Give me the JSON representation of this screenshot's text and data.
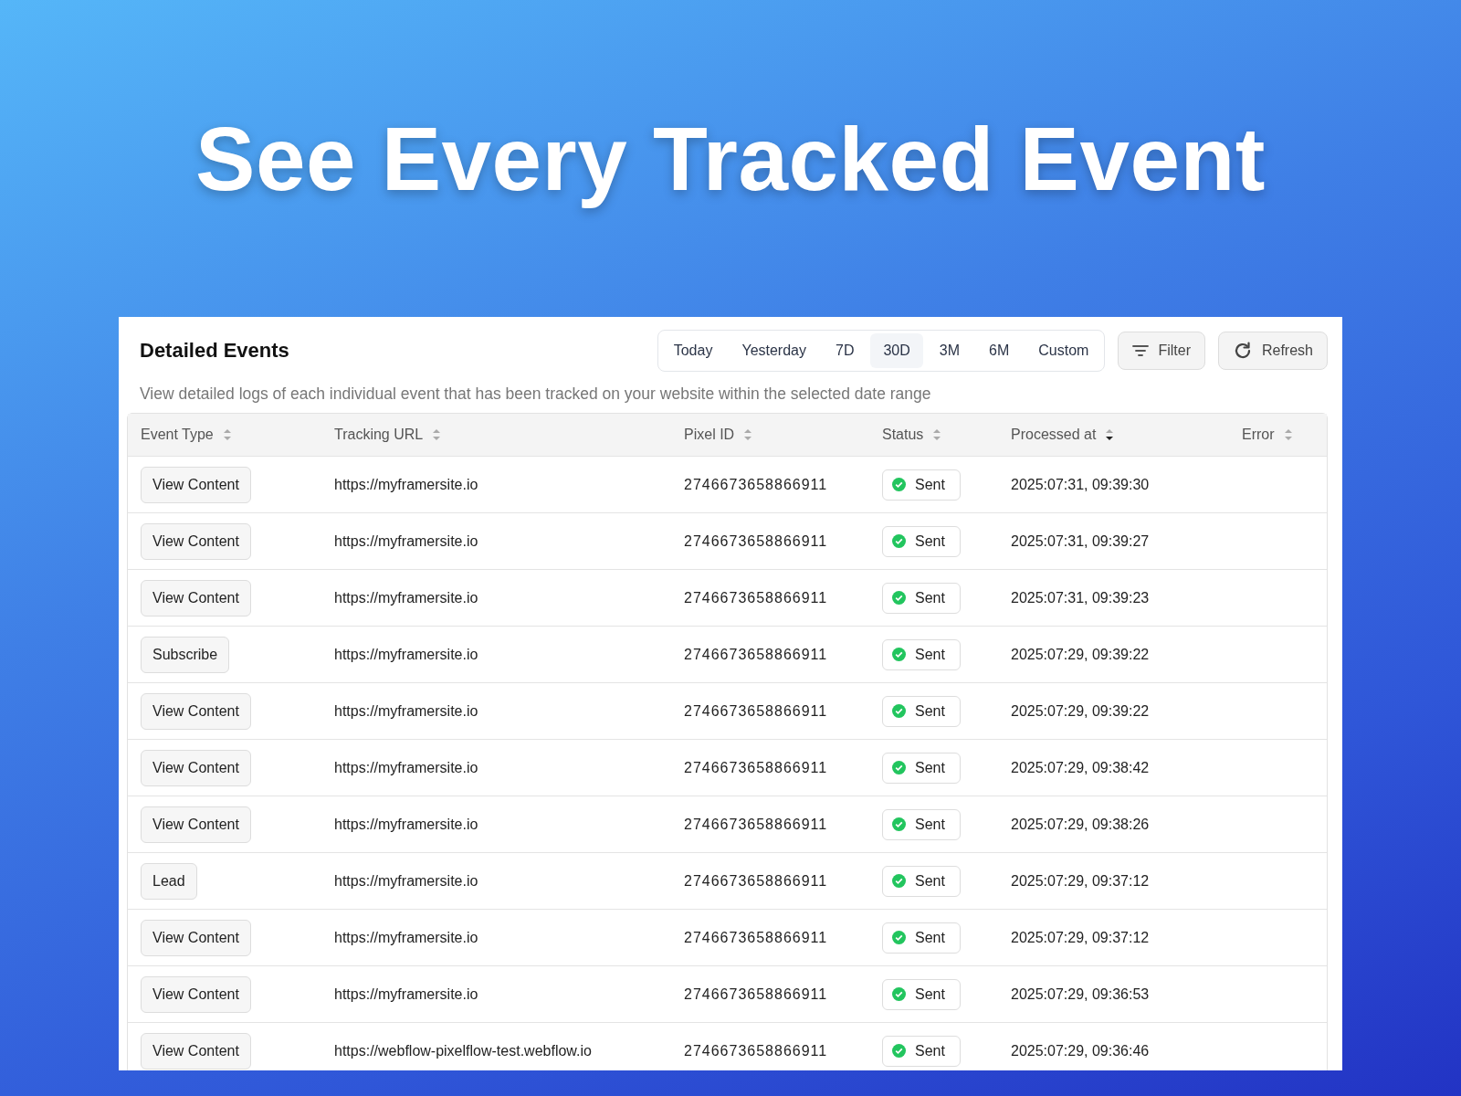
{
  "headline": "See Every Tracked Event",
  "panel": {
    "title": "Detailed Events",
    "description": "View detailed logs of each individual event that has been tracked on your website within the selected date range",
    "ranges": [
      {
        "label": "Today",
        "selected": false
      },
      {
        "label": "Yesterday",
        "selected": false
      },
      {
        "label": "7D",
        "selected": false
      },
      {
        "label": "30D",
        "selected": true
      },
      {
        "label": "3M",
        "selected": false
      },
      {
        "label": "6M",
        "selected": false
      },
      {
        "label": "Custom",
        "selected": false
      }
    ],
    "buttons": [
      {
        "label": "Filter",
        "kind": "filter"
      },
      {
        "label": "Refresh",
        "kind": "refresh"
      }
    ]
  },
  "table": {
    "columns": [
      {
        "label": "Event Type",
        "sorted": false
      },
      {
        "label": "Tracking URL",
        "sorted": false
      },
      {
        "label": "Pixel ID",
        "sorted": false
      },
      {
        "label": "Status",
        "sorted": false
      },
      {
        "label": "Processed at",
        "sorted": true
      },
      {
        "label": "Error",
        "sorted": false
      }
    ],
    "rows": [
      {
        "event_type": "View Content",
        "url": "https://myframersite.io",
        "pixel_id": "2746673658866911",
        "status": "Sent",
        "processed_at": "2025:07:31, 09:39:30"
      },
      {
        "event_type": "View Content",
        "url": "https://myframersite.io",
        "pixel_id": "2746673658866911",
        "status": "Sent",
        "processed_at": "2025:07:31, 09:39:27"
      },
      {
        "event_type": "View Content",
        "url": "https://myframersite.io",
        "pixel_id": "2746673658866911",
        "status": "Sent",
        "processed_at": "2025:07:31, 09:39:23"
      },
      {
        "event_type": "Subscribe",
        "url": "https://myframersite.io",
        "pixel_id": "2746673658866911",
        "status": "Sent",
        "processed_at": "2025:07:29, 09:39:22"
      },
      {
        "event_type": "View Content",
        "url": "https://myframersite.io",
        "pixel_id": "2746673658866911",
        "status": "Sent",
        "processed_at": "2025:07:29, 09:39:22"
      },
      {
        "event_type": "View Content",
        "url": "https://myframersite.io",
        "pixel_id": "2746673658866911",
        "status": "Sent",
        "processed_at": "2025:07:29, 09:38:42"
      },
      {
        "event_type": "View Content",
        "url": "https://myframersite.io",
        "pixel_id": "2746673658866911",
        "status": "Sent",
        "processed_at": "2025:07:29, 09:38:26"
      },
      {
        "event_type": "Lead",
        "url": "https://myframersite.io",
        "pixel_id": "2746673658866911",
        "status": "Sent",
        "processed_at": "2025:07:29, 09:37:12"
      },
      {
        "event_type": "View Content",
        "url": "https://myframersite.io",
        "pixel_id": "2746673658866911",
        "status": "Sent",
        "processed_at": "2025:07:29, 09:37:12"
      },
      {
        "event_type": "View Content",
        "url": "https://myframersite.io",
        "pixel_id": "2746673658866911",
        "status": "Sent",
        "processed_at": "2025:07:29, 09:36:53"
      },
      {
        "event_type": "View Content",
        "url": "https://webflow-pixelflow-test.webflow.io",
        "pixel_id": "2746673658866911",
        "status": "Sent",
        "processed_at": "2025:07:29, 09:36:46"
      }
    ]
  }
}
